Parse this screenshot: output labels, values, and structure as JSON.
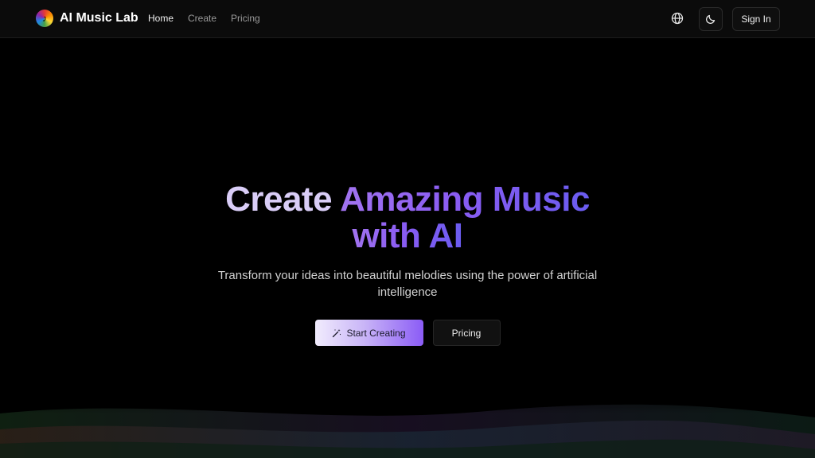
{
  "header": {
    "brand_name": "AI Music Lab",
    "nav": [
      {
        "label": "Home",
        "active": true
      },
      {
        "label": "Create",
        "active": false
      },
      {
        "label": "Pricing",
        "active": false
      }
    ],
    "sign_in_label": "Sign In",
    "icons": [
      "music-logo-icon",
      "globe-icon",
      "moon-icon"
    ]
  },
  "hero": {
    "headline_part1": "Create ",
    "headline_part2": "Amazing Music",
    "headline_line2": "with AI",
    "subtitle": "Transform your ideas into beautiful melodies using the power of artificial intelligence",
    "primary_button": "Start Creating",
    "secondary_button": "Pricing"
  },
  "colors": {
    "background": "#000000",
    "accent_start": "#a274f0",
    "accent_end": "#6a5cf0"
  }
}
